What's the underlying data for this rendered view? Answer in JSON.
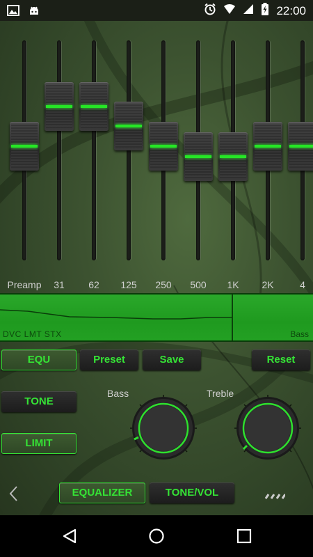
{
  "status_bar": {
    "time": "22:00",
    "left_icons": [
      "image-icon",
      "android-icon"
    ],
    "right_icons": [
      "alarm-icon",
      "wifi-icon",
      "signal-icon",
      "battery-charging-icon"
    ]
  },
  "equalizer": {
    "bands": [
      {
        "label": "Preamp",
        "level": 0.52
      },
      {
        "label": "31",
        "level": 0.7
      },
      {
        "label": "62",
        "level": 0.7
      },
      {
        "label": "125",
        "level": 0.61
      },
      {
        "label": "250",
        "level": 0.52
      },
      {
        "label": "500",
        "level": 0.47
      },
      {
        "label": "1K",
        "level": 0.47
      },
      {
        "label": "2K",
        "level": 0.52
      },
      {
        "label": "4",
        "level": 0.52
      }
    ],
    "curve_label_left": "DVC LMT STX",
    "curve_label_right": "Bass"
  },
  "buttons": {
    "equ": "EQU",
    "preset": "Preset",
    "save": "Save",
    "reset": "Reset",
    "tone": "TONE",
    "limit": "LIMIT"
  },
  "knobs": {
    "bass_label": "Bass",
    "treble_label": "Treble"
  },
  "tabs": {
    "equalizer": "EQUALIZER",
    "tone_vol": "TONE/VOL"
  },
  "colors": {
    "accent": "#35e335",
    "panel": "#22a022",
    "background": "#3c5230"
  }
}
